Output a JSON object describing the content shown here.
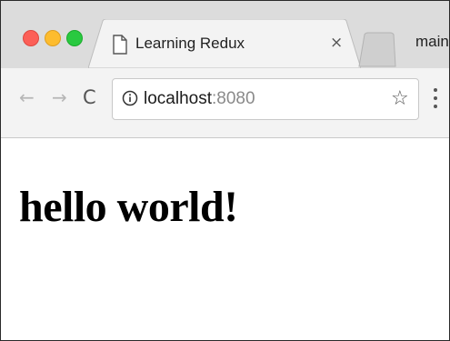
{
  "window": {
    "controls": [
      "close",
      "minimize",
      "zoom"
    ]
  },
  "tab": {
    "title": "Learning Redux",
    "close_label": "×",
    "icon": "document-icon"
  },
  "profile": {
    "label": "main"
  },
  "toolbar": {
    "back_icon": "←",
    "forward_icon": "→",
    "reload_icon": "C",
    "url_host": "localhost",
    "url_port": ":8080",
    "bookmark_icon": "☆"
  },
  "page": {
    "heading": "hello world!"
  }
}
